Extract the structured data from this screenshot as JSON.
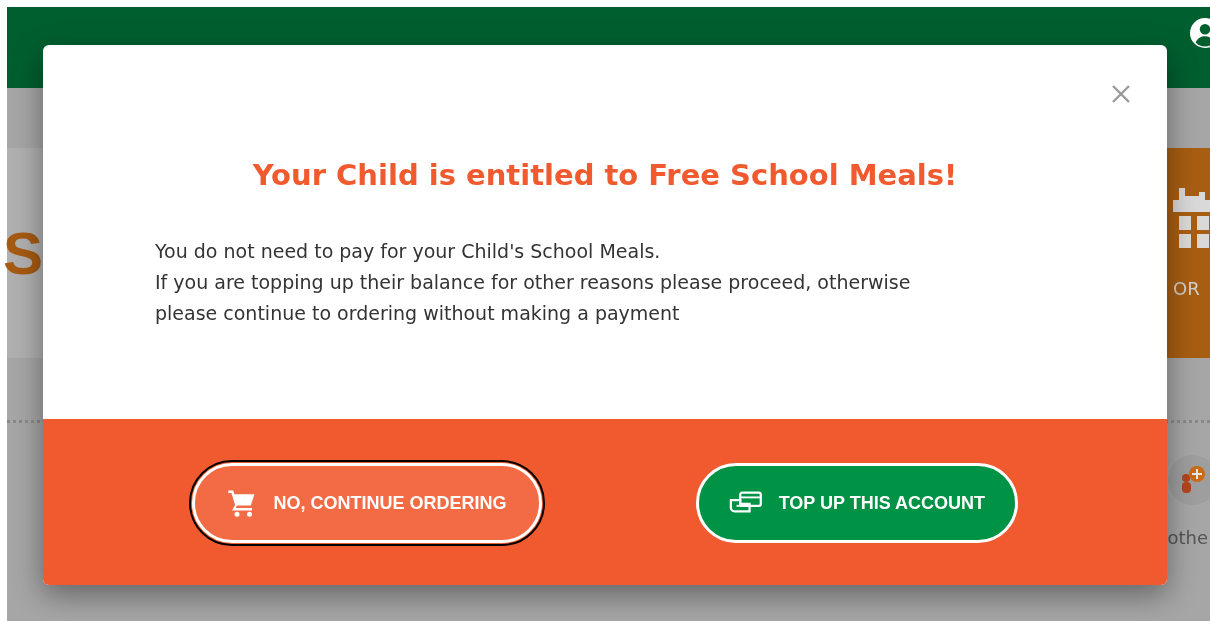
{
  "background": {
    "left_card_text": "S",
    "right_card_text": "OR",
    "right_item_text": "othe"
  },
  "dialog": {
    "title": "Your Child is entitled to Free School Meals!",
    "paragraphs": [
      "You do not need to pay for your Child's School Meals.",
      "If you are topping up their balance for other reasons please proceed, otherwise please continue to ordering without making a payment"
    ],
    "buttons": [
      {
        "label": "NO, CONTINUE ORDERING",
        "kind": "secondary",
        "focused": true
      },
      {
        "label": "TOP UP THIS ACCOUNT",
        "kind": "primary",
        "focused": false
      }
    ]
  }
}
